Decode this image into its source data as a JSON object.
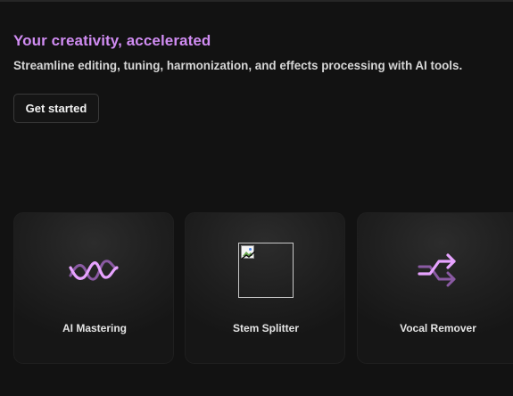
{
  "hero": {
    "headline": "Your creativity, accelerated",
    "subline": "Streamline editing, tuning, harmonization, and effects processing with AI tools.",
    "cta_label": "Get started"
  },
  "tools": [
    {
      "label": "AI Mastering",
      "icon": "waveform-icon"
    },
    {
      "label": "Stem Splitter",
      "icon": "broken-image-icon"
    },
    {
      "label": "Vocal Remover",
      "icon": "swap-arrows-icon"
    }
  ],
  "colors": {
    "background": "#121212",
    "accent": "#d08cf2",
    "accent_muted": "#8a5aa3",
    "card": "#1f1f1f",
    "text": "#e4e4e4"
  }
}
